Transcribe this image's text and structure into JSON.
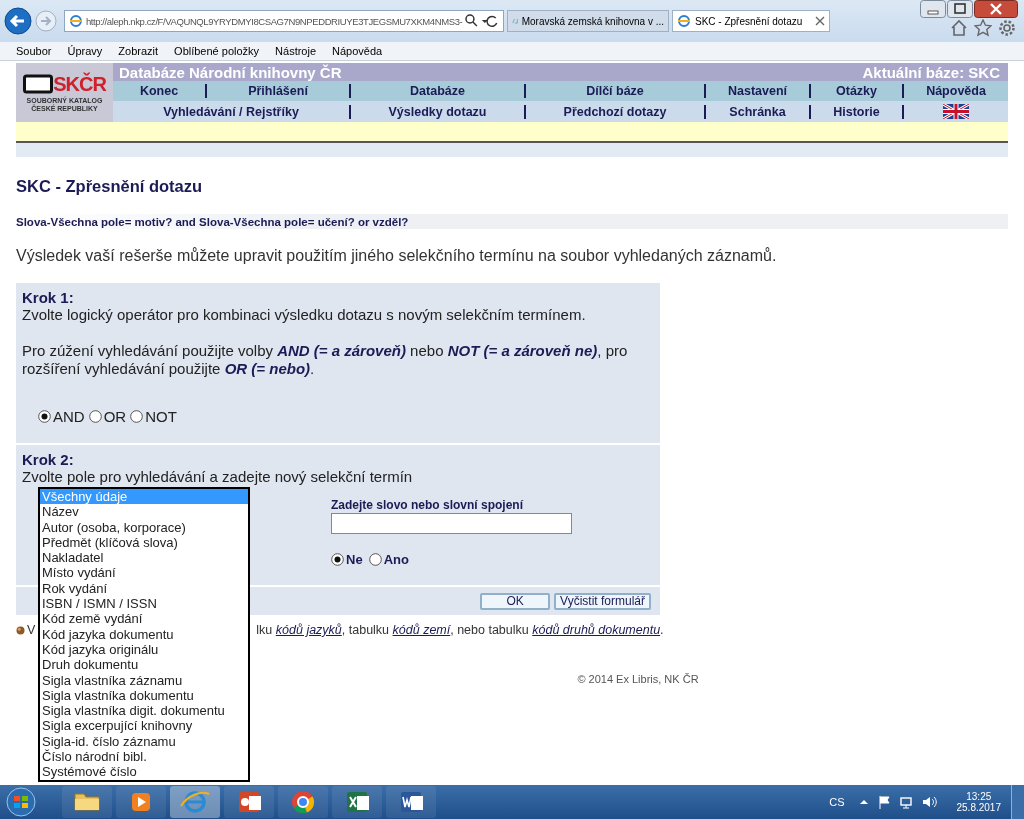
{
  "browser": {
    "address": "http://aleph.nkp.cz/F/VAQUNQL9YRYDMYI8CSAG7N9NPEDDRIUYE3TJEGSMU7XKM4NMS3-",
    "tabs": [
      {
        "title": "Moravská zemská knihovna v ...",
        "selected": false
      },
      {
        "title": "SKC - Zpřesnění dotazu",
        "selected": true
      }
    ],
    "menu": [
      "Soubor",
      "Úpravy",
      "Zobrazit",
      "Oblíbené položky",
      "Nástroje",
      "Nápověda"
    ]
  },
  "header": {
    "logo_text": "SKČR",
    "logo_subtitle": "SOUBORNÝ KATALOG ČESKÉ REPUBLIKY",
    "title": "Databáze Národní knihovny ČR",
    "current_db": "Aktuální báze:  SKC",
    "nav_row1": [
      "Konec",
      "Přihlášení",
      "Databáze",
      "Dílčí báze",
      "Nastavení",
      "Otázky",
      "Nápověda"
    ],
    "nav_row2": [
      "Vyhledávání / Rejstříky",
      "Výsledky dotazu",
      "Předchozí dotazy",
      "Schránka",
      "Historie"
    ]
  },
  "page_title": "SKC - Zpřesnění dotazu",
  "query": "Slova-Všechna pole= motiv? and Slova-Všechna pole= učení? or vzděl?",
  "description": "Výsledek vaší rešerše můžete upravit použitím jiného selekčního termínu na soubor vyhledaných záznamů.",
  "step1": {
    "heading": "Krok 1:",
    "text": "Zvolte logický operátor pro kombinaci výsledku dotazu s novým selekčním termínem.",
    "hint": "Pro zúžení vyhledávání použijte volby **AND (= a zároveň)** nebo **NOT (= a zároveň ne)**, pro rozšíření vyhledávání použijte **OR (= nebo)**.",
    "operators": [
      {
        "label": "AND",
        "selected": true
      },
      {
        "label": "OR",
        "selected": false
      },
      {
        "label": "NOT",
        "selected": false
      }
    ]
  },
  "step2": {
    "heading": "Krok 2:",
    "text": "Zvolte pole pro vyhledávání a zadejte nový selekční termín",
    "fields": [
      {
        "label": "Všechny údaje",
        "selected": true
      },
      {
        "label": "Název",
        "selected": false
      },
      {
        "label": "Autor (osoba, korporace)",
        "selected": false
      },
      {
        "label": "Předmět (klíčová slova)",
        "selected": false
      },
      {
        "label": "Nakladatel",
        "selected": false
      },
      {
        "label": "Místo vydání",
        "selected": false
      },
      {
        "label": "Rok vydání",
        "selected": false
      },
      {
        "label": "ISBN / ISMN / ISSN",
        "selected": false
      },
      {
        "label": "Kód země vydání",
        "selected": false
      },
      {
        "label": "Kód jazyka dokumentu",
        "selected": false
      },
      {
        "label": "Kód jazyka originálu",
        "selected": false
      },
      {
        "label": "Druh dokumentu",
        "selected": false
      },
      {
        "label": "Sigla vlastníka záznamu",
        "selected": false
      },
      {
        "label": "Sigla vlastníka dokumentu",
        "selected": false
      },
      {
        "label": "Sigla vlastníka digit. dokumentu",
        "selected": false
      },
      {
        "label": "Sigla excerpující knihovny",
        "selected": false
      },
      {
        "label": "Sigla-id. číslo záznamu",
        "selected": false
      },
      {
        "label": "Číslo národní bibl.",
        "selected": false
      },
      {
        "label": "Systémové číslo",
        "selected": false
      }
    ],
    "term_label": "Zadejte slovo nebo slovní spojení",
    "options": [
      {
        "label": "Ne",
        "selected": true
      },
      {
        "label": "Ano",
        "selected": false
      }
    ]
  },
  "buttons": [
    "OK",
    "Vyčistit formulář"
  ],
  "note": {
    "start": "V",
    "parts": [
      {
        "kind": "text",
        "text": "lku "
      },
      {
        "kind": "link",
        "text": "kódů jazyků"
      },
      {
        "kind": "text",
        "text": ", tabulku "
      },
      {
        "kind": "link",
        "text": "kódů zemí"
      },
      {
        "kind": "text",
        "text": ", nebo tabulku "
      },
      {
        "kind": "link",
        "text": "kódů druhů dokumentu"
      },
      {
        "kind": "text",
        "text": "."
      }
    ]
  },
  "footer": "© 2014 Ex Libris, NK ČR",
  "taskbar": {
    "apps": [
      {
        "kind": "folder",
        "selected": false
      },
      {
        "kind": "media",
        "selected": false
      },
      {
        "kind": "browser",
        "selected": true
      },
      {
        "kind": "slides",
        "selected": false
      },
      {
        "kind": "chrome",
        "selected": false
      },
      {
        "kind": "sheet",
        "selected": false
      },
      {
        "kind": "doc",
        "selected": false
      }
    ],
    "language": "CS",
    "time": "13:25",
    "date": "25.8.2017"
  }
}
